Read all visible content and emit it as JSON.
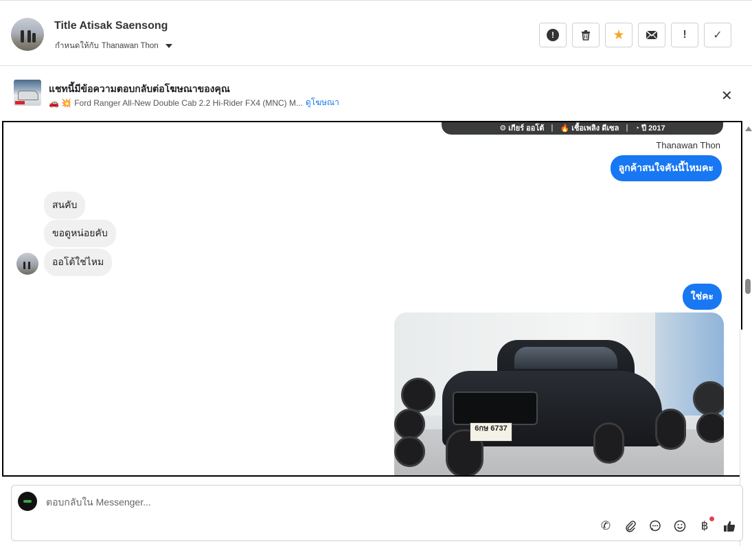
{
  "header": {
    "name": "Title Atisak Saensong",
    "assign_label": "กำหนดให้กับ",
    "assignee": "Thanawan Thon",
    "buttons": [
      {
        "name": "spam-report-button",
        "icon": "alert-circle-icon",
        "glyph": "!"
      },
      {
        "name": "delete-button",
        "icon": "trash-icon",
        "glyph": "🗑"
      },
      {
        "name": "star-button",
        "icon": "star-icon",
        "glyph": "★"
      },
      {
        "name": "mark-unread-button",
        "icon": "envelope-icon",
        "glyph": "✉"
      },
      {
        "name": "follow-up-button",
        "icon": "exclamation-icon",
        "glyph": "!"
      },
      {
        "name": "mark-done-button",
        "icon": "check-icon",
        "glyph": "✓"
      }
    ]
  },
  "ad": {
    "title": "แชทนี้มีข้อความตอบกลับต่อโฆษณาของคุณ",
    "emoji": "🚗 💥",
    "description": "Ford Ranger All-New Double Cab 2.2 Hi-Rider FX4 (MNC) M...",
    "link": "ดูโฆษณา",
    "thumb_plate_text": "30,000"
  },
  "chat": {
    "spec_bar": {
      "gear": "⚙ เกียร์ ออโต้",
      "fuel": "🔥 เชื้อเพลิง ดีเซล",
      "year": "◔ ปี 2017",
      "sep": "|"
    },
    "sender_name": "Thanawan Thon",
    "messages": [
      {
        "dir": "out",
        "text": "ลูกค้าสนใจคันนี้ไหมคะ"
      },
      {
        "dir": "in",
        "text": "สนคับ"
      },
      {
        "dir": "in",
        "text": "ขอดูหน่อยคับ"
      },
      {
        "dir": "in",
        "text": "ออโต้ใช่ไหม"
      },
      {
        "dir": "out",
        "text": "ใช่คะ"
      }
    ],
    "photo_plate": "6กษ 6737"
  },
  "composer": {
    "placeholder": "ตอบกลับใน Messenger...",
    "tools": [
      {
        "name": "call-icon",
        "glyph": "✆"
      },
      {
        "name": "attach-icon",
        "glyph": "📎"
      },
      {
        "name": "saved-reply-icon",
        "glyph": "💬"
      },
      {
        "name": "emoji-icon",
        "glyph": "☺"
      },
      {
        "name": "payment-icon",
        "glyph": "฿"
      },
      {
        "name": "like-icon",
        "glyph": "👍"
      }
    ]
  },
  "colors": {
    "accent": "#1877f2",
    "incoming_bubble": "#f0f0f0",
    "star": "#f5a623",
    "spec_bar": "#3a3b3c"
  }
}
